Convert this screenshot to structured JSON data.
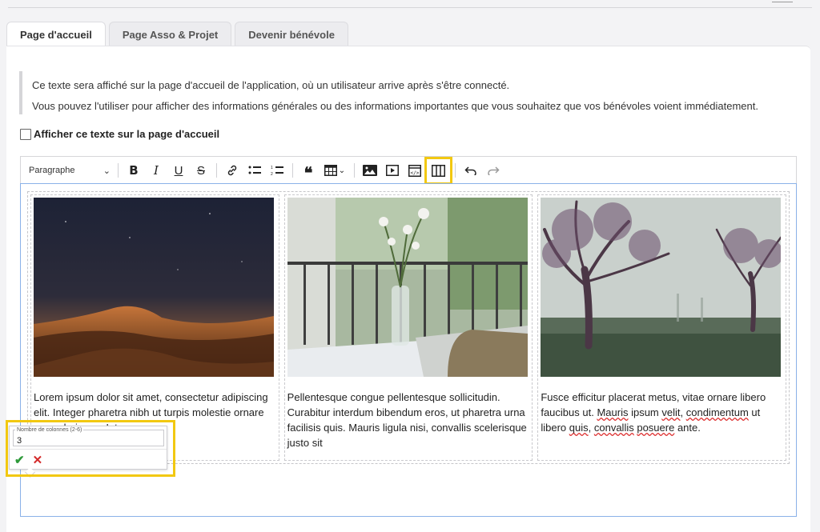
{
  "tabs": [
    {
      "label": "Page d'accueil",
      "active": true
    },
    {
      "label": "Page Asso & Projet",
      "active": false
    },
    {
      "label": "Devenir bénévole",
      "active": false
    }
  ],
  "info": {
    "line1": "Ce texte sera affiché sur la page d'accueil de l'application, où un utilisateur arrive après s'être connecté.",
    "line2": "Vous pouvez l'utiliser pour afficher des informations générales ou des informations importantes que vous souhaitez que vos bénévoles voient immédiatement."
  },
  "checkbox": {
    "label": "Afficher ce texte sur la page d'accueil",
    "checked": false
  },
  "toolbar": {
    "format_select": "Paragraphe",
    "icons": [
      "bold-icon",
      "italic-icon",
      "underline-icon",
      "strikethrough-icon",
      "link-icon",
      "bulleted-list-icon",
      "numbered-list-icon",
      "blockquote-icon",
      "table-icon",
      "image-icon",
      "media-icon",
      "html-embed-icon",
      "columns-icon",
      "undo-icon",
      "redo-icon"
    ],
    "highlight_color": "#f2c811"
  },
  "columns": [
    {
      "image": "desert-dunes-night",
      "text": "Lorem ipsum dolor sit amet, consectetur adipiscing elit. Integer pharetra nibh ut turpis molestie ornare ex scelerisque. Integer"
    },
    {
      "image": "flowers-in-vase-balcony",
      "text": "Pellentesque congue pellentesque sollicitudin. Curabitur interdum bibendum eros, ut pharetra urna facilisis quis. Mauris ligula nisi, convallis scelerisque justo sit"
    },
    {
      "image": "misty-trees-park",
      "text_a": "Fusce efficitur placerat metus, vitae ornare libero faucibus ut. ",
      "text_b": "Mauris",
      "text_c": " ipsum ",
      "text_d": "velit",
      "text_e": ", ",
      "text_f": "condimentum",
      "text_g": " ut libero ",
      "text_h": "quis",
      "text_i": ", ",
      "text_j": "convallis",
      "text_k": " ",
      "text_l": "posuere",
      "text_m": " ante."
    }
  ],
  "popup": {
    "label": "Nombre de colonnes (2-6)",
    "value": "3",
    "confirm": "✔",
    "cancel": "✕"
  }
}
